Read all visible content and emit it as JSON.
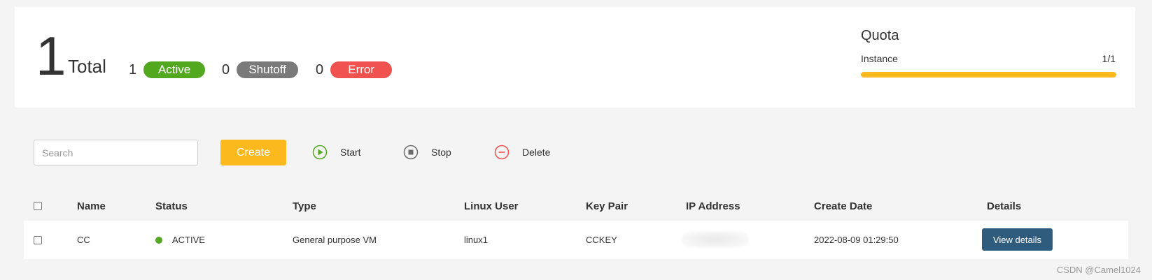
{
  "summary": {
    "total_count": "1",
    "total_label": "Total",
    "stats": [
      {
        "count": "1",
        "label": "Active",
        "color": "#52a91f"
      },
      {
        "count": "0",
        "label": "Shutoff",
        "color": "#7a7a7a"
      },
      {
        "count": "0",
        "label": "Error",
        "color": "#f0524f"
      }
    ]
  },
  "quota": {
    "title": "Quota",
    "label": "Instance",
    "value": "1/1",
    "fraction": 1.0,
    "bar_color": "#fbb91e"
  },
  "toolbar": {
    "search_placeholder": "Search",
    "create_label": "Create",
    "create_color": "#fbb91e",
    "start_label": "Start",
    "start_icon": "play-circle-icon",
    "start_color": "#52a91f",
    "stop_label": "Stop",
    "stop_icon": "stop-circle-icon",
    "stop_color": "#6b6b6b",
    "delete_label": "Delete",
    "delete_icon": "minus-circle-icon",
    "delete_color": "#f0524f"
  },
  "table": {
    "headers": [
      "Name",
      "Status",
      "Type",
      "Linux User",
      "Key Pair",
      "IP Address",
      "Create Date",
      "Details"
    ],
    "rows": [
      {
        "name": "CC",
        "status": "ACTIVE",
        "status_color": "#52a91f",
        "type": "General purpose VM",
        "linux_user": "linux1",
        "key_pair": "CCKEY",
        "ip_address": "",
        "create_date": "2022-08-09 01:29:50",
        "details_label": "View details",
        "details_color": "#2f5b7d"
      }
    ]
  },
  "watermark": "CSDN @Camel1024"
}
